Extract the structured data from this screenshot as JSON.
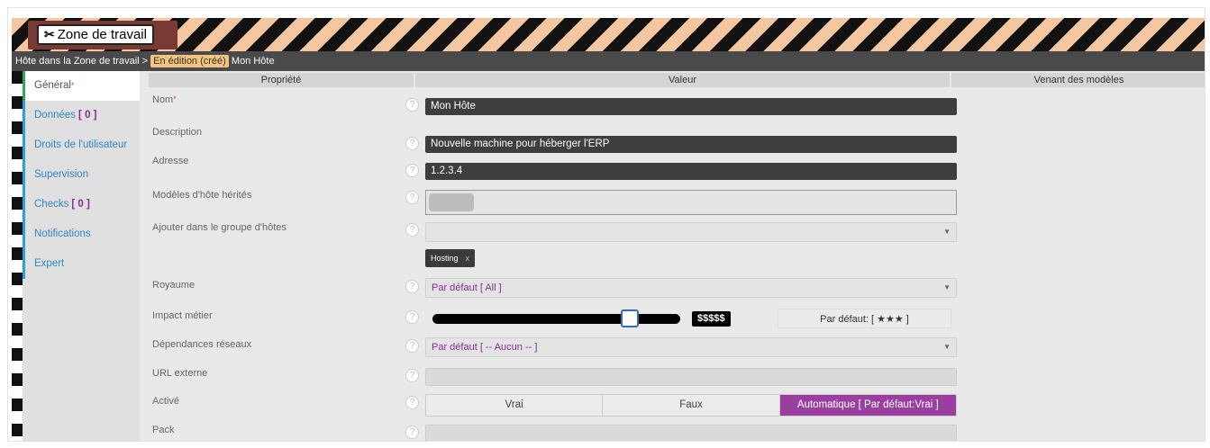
{
  "header": {
    "workzone_label": "Zone de travail",
    "breadcrumb_prefix": "Hôte dans la Zone de travail >",
    "breadcrumb_badge": "En édition (créé)",
    "breadcrumb_name": "Mon Hôte"
  },
  "sidebar": {
    "items": [
      {
        "label": "Général",
        "required": "*"
      },
      {
        "label": "Données",
        "count": "[ 0 ]"
      },
      {
        "label": "Droits de l'utilisateur"
      },
      {
        "label": "Supervision"
      },
      {
        "label": "Checks",
        "count": "[ 0 ]"
      },
      {
        "label": "Notifications"
      },
      {
        "label": "Expert"
      }
    ]
  },
  "table": {
    "headers": [
      "Propriété",
      "Valeur",
      "Venant des modèles"
    ]
  },
  "fields": {
    "nom": {
      "label": "Nom",
      "required": "*",
      "value": "Mon Hôte"
    },
    "description": {
      "label": "Description",
      "value": "Nouvelle machine pour héberger l'ERP"
    },
    "adresse": {
      "label": "Adresse",
      "value": "1.2.3.4"
    },
    "modeles": {
      "label": "Modèles d'hôte hérités"
    },
    "groupe": {
      "label": "Ajouter dans le groupe d'hôtes",
      "tag": "Hosting",
      "tag_remove": "x"
    },
    "royaume": {
      "label": "Royaume",
      "value": "Par défaut [ All ]"
    },
    "impact": {
      "label": "Impact métier",
      "value_display": "$$$$$",
      "default": "Par défaut: [ ★★★ ]",
      "slider_fraction": 0.8
    },
    "dependances": {
      "label": "Dépendances réseaux",
      "value": "Par défaut [ -- Aucun -- ]"
    },
    "url": {
      "label": "URL externe"
    },
    "active": {
      "label": "Activé",
      "options": [
        "Vrai",
        "Faux",
        "Automatique [ Par défaut:Vrai ]"
      ],
      "selected": 2
    },
    "pack": {
      "label": "Pack"
    }
  },
  "help_glyph": "?",
  "caret_glyph": "▼",
  "colors": {
    "accent": "#9a3fa0",
    "link": "#2f86c6",
    "active_marker": "#2fa85a"
  }
}
